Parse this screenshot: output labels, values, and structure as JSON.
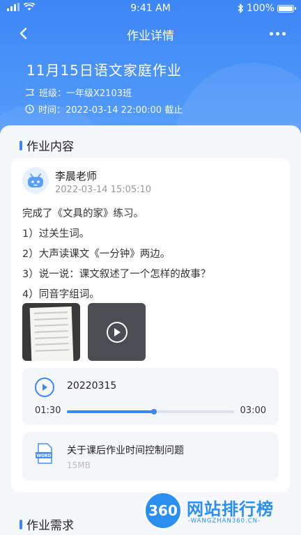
{
  "status_bar": {
    "time": "9:41 AM",
    "battery": "100%"
  },
  "nav": {
    "title": "作业详情"
  },
  "homework": {
    "title": "11月15日语文家庭作业",
    "class_text": "班级：一年级X2103班",
    "deadline_text": "时间：2022-03-14 22:00:00 截止"
  },
  "sections": {
    "content_title": "作业内容",
    "requirements_title": "作业需求"
  },
  "post": {
    "teacher": "李晨老师",
    "posted_at": "2022-03-14 15:05:10",
    "lines": [
      "完成了《文具的家》练习。",
      "1）过关生词。",
      "2）大声读课文《一分钟》两边。",
      "3）说一说：课文叙述了一个怎样的故事？",
      "4）同音字组词。"
    ]
  },
  "audio": {
    "name": "20220315",
    "current": "01:30",
    "duration": "03:00",
    "progress": 0.52
  },
  "file": {
    "name": "关于课后作业时间控制问题",
    "size": "15MB",
    "icon": "word-icon"
  },
  "watermark": {
    "logo": "360",
    "text": "网站排行榜",
    "url": "-WANGZHAN360.CN-"
  },
  "colors": {
    "accent": "#3d86f5",
    "header": "#4f98f9"
  }
}
